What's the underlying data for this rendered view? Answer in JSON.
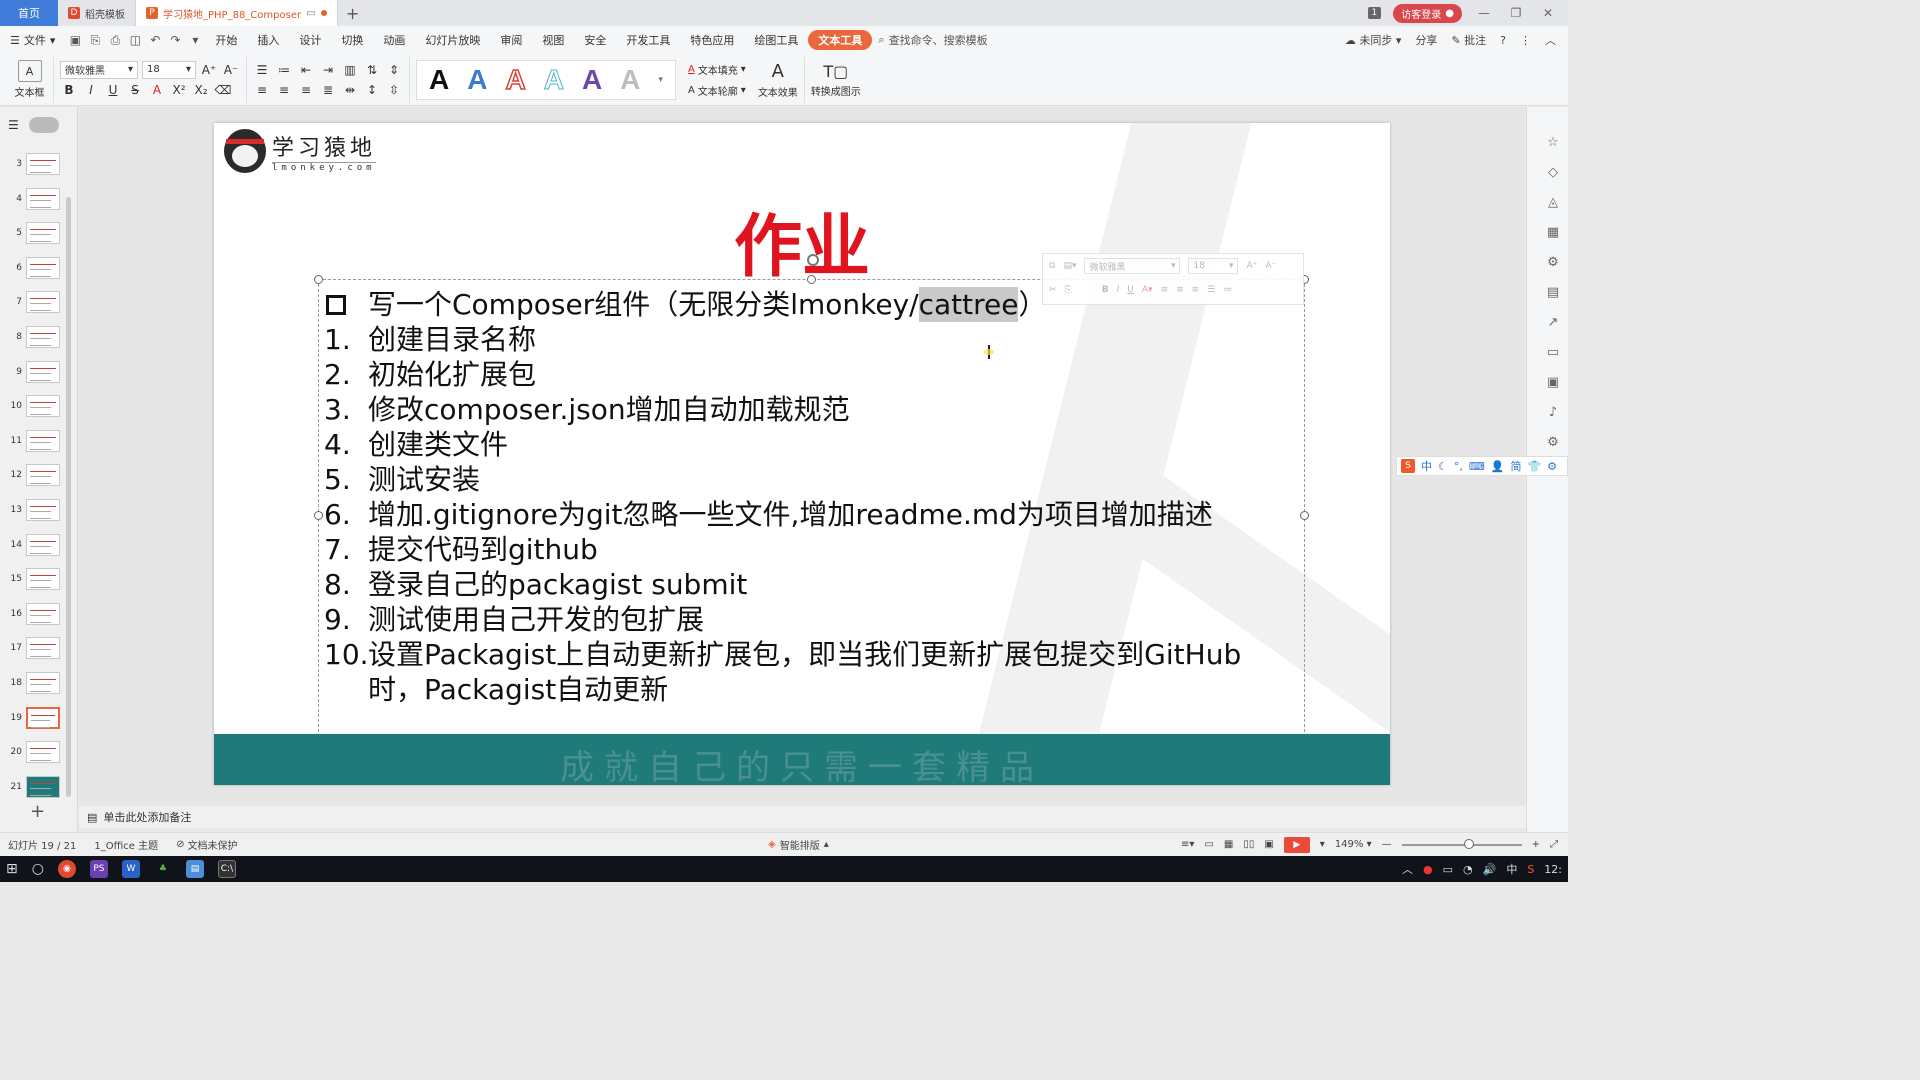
{
  "tabs": {
    "home": "首页",
    "template": "稻壳模板",
    "document": "学习猿地_PHP_88_Composer"
  },
  "titlebar": {
    "page_badge": "1",
    "login": "访客登录"
  },
  "menu": {
    "file": "文件",
    "items": [
      "开始",
      "插入",
      "设计",
      "切换",
      "动画",
      "幻灯片放映",
      "审阅",
      "视图",
      "安全",
      "开发工具",
      "特色应用",
      "绘图工具",
      "文本工具"
    ],
    "search": "查找命令、搜索模板",
    "sync": "未同步",
    "share": "分享",
    "comment": "批注"
  },
  "ribbon": {
    "textbox": "文本框",
    "font_name": "微软雅黑",
    "font_size": "18",
    "style_letter": "A",
    "text_fill": "文本填充",
    "text_outline": "文本轮廓",
    "text_effect": "文本效果",
    "convert": "转换成图示"
  },
  "thumbnails": [
    "3",
    "4",
    "5",
    "6",
    "7",
    "8",
    "9",
    "10",
    "11",
    "12",
    "13",
    "14",
    "15",
    "16",
    "17",
    "18",
    "19",
    "20",
    "21"
  ],
  "slide": {
    "logo_cn": "学习猿地",
    "logo_en": "lmonkey.com",
    "title": "作业",
    "heading_prefix": "写一个Composer组件（无限分类lmonkey/",
    "heading_highlight": "cattree",
    "heading_suffix": "）",
    "items": [
      {
        "num": "1.",
        "text": "创建目录名称"
      },
      {
        "num": "2.",
        "text": "初始化扩展包"
      },
      {
        "num": "3.",
        "text": "修改composer.json增加自动加载规范"
      },
      {
        "num": "4.",
        "text": "创建类文件"
      },
      {
        "num": "5.",
        "text": "测试安装"
      },
      {
        "num": "6.",
        "text": "增加.gitignore为git忽略一些文件,增加readme.md为项目增加描述"
      },
      {
        "num": "7.",
        "text": "提交代码到github"
      },
      {
        "num": "8.",
        "text": "登录自己的packagist submit"
      },
      {
        "num": "9.",
        "text": "测试使用自己开发的包扩展"
      },
      {
        "num": "10.",
        "text": "设置Packagist上自动更新扩展包，即当我们更新扩展包提交到GitHub"
      }
    ],
    "item_continuation": "时，Packagist自动更新",
    "mini_font": "微软雅黑",
    "mini_size": "18",
    "footer": "成就自己的只需一套精品"
  },
  "ime": {
    "mode": "中",
    "simplified": "简"
  },
  "notes": {
    "placeholder": "单击此处添加备注"
  },
  "status": {
    "slide_pos": "幻灯片 19 / 21",
    "theme": "1_Office 主题",
    "protect": "文档未保护",
    "smart": "智能排版",
    "zoom": "149%"
  },
  "taskbar": {
    "ime": "中",
    "clock": "12:"
  },
  "colors": {
    "accent": "#e8673c",
    "title_red": "#e0141e",
    "footer_teal": "#1f7b7a",
    "home_tab": "#3f7bd8"
  }
}
